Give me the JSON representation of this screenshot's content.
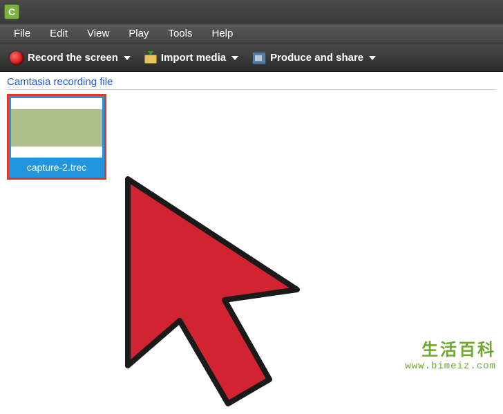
{
  "app": {
    "initial": "C"
  },
  "menu": {
    "file": "File",
    "edit": "Edit",
    "view": "View",
    "play": "Play",
    "tools": "Tools",
    "help": "Help"
  },
  "toolbar": {
    "record": "Record the screen",
    "import": "Import media",
    "produce": "Produce and share"
  },
  "content": {
    "section_label": "Camtasia recording file",
    "file": {
      "name": "capture-2.trec"
    }
  },
  "watermark": {
    "zh": "生活百科",
    "url": "www.bimeiz.com"
  },
  "colors": {
    "highlight_border": "#e2352b",
    "selection_bg": "#2196de",
    "cursor_fill": "#d22430"
  }
}
